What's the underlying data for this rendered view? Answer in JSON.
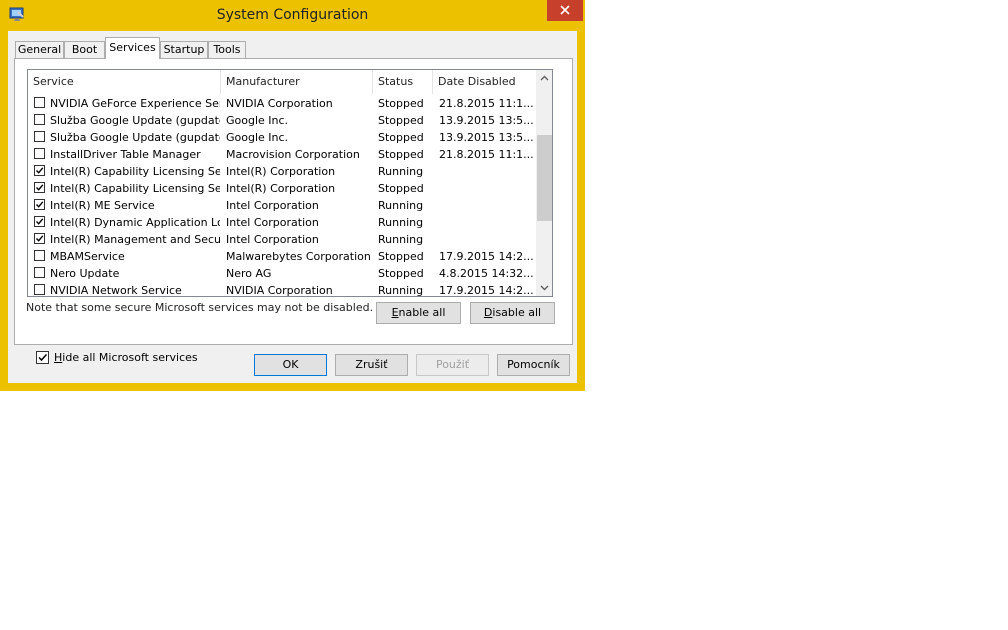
{
  "window": {
    "title": "System Configuration",
    "accent": "#ecc200",
    "close_color": "#c7402b"
  },
  "tabs": [
    {
      "label": "General",
      "active": false
    },
    {
      "label": "Boot",
      "active": false
    },
    {
      "label": "Services",
      "active": true
    },
    {
      "label": "Startup",
      "active": false
    },
    {
      "label": "Tools",
      "active": false
    }
  ],
  "services": {
    "columns": [
      "Service",
      "Manufacturer",
      "Status",
      "Date Disabled"
    ],
    "rows": [
      {
        "checked": false,
        "service": "NVIDIA GeForce Experience Ser...",
        "manufacturer": "NVIDIA Corporation",
        "status": "Stopped",
        "date": "21.8.2015 11:1..."
      },
      {
        "checked": false,
        "service": "Služba Google Update (gupdate)",
        "manufacturer": "Google Inc.",
        "status": "Stopped",
        "date": "13.9.2015 13:5..."
      },
      {
        "checked": false,
        "service": "Služba Google Update (gupdatem)",
        "manufacturer": "Google Inc.",
        "status": "Stopped",
        "date": "13.9.2015 13:5..."
      },
      {
        "checked": false,
        "service": "InstallDriver Table Manager",
        "manufacturer": "Macrovision Corporation",
        "status": "Stopped",
        "date": "21.8.2015 11:1..."
      },
      {
        "checked": true,
        "service": "Intel(R) Capability Licensing Ser...",
        "manufacturer": "Intel(R) Corporation",
        "status": "Running",
        "date": ""
      },
      {
        "checked": true,
        "service": "Intel(R) Capability Licensing Ser...",
        "manufacturer": "Intel(R) Corporation",
        "status": "Stopped",
        "date": ""
      },
      {
        "checked": true,
        "service": "Intel(R) ME Service",
        "manufacturer": "Intel Corporation",
        "status": "Running",
        "date": ""
      },
      {
        "checked": true,
        "service": "Intel(R) Dynamic Application Loa...",
        "manufacturer": "Intel Corporation",
        "status": "Running",
        "date": ""
      },
      {
        "checked": true,
        "service": "Intel(R) Management and Securi...",
        "manufacturer": "Intel Corporation",
        "status": "Running",
        "date": ""
      },
      {
        "checked": false,
        "service": "MBAMService",
        "manufacturer": "Malwarebytes Corporation",
        "status": "Stopped",
        "date": "17.9.2015 14:2..."
      },
      {
        "checked": false,
        "service": "Nero Update",
        "manufacturer": "Nero AG",
        "status": "Stopped",
        "date": "4.8.2015 14:32..."
      },
      {
        "checked": false,
        "service": "NVIDIA Network Service",
        "manufacturer": "NVIDIA Corporation",
        "status": "Running",
        "date": "17.9.2015 14:2..."
      }
    ]
  },
  "note": "Note that some secure Microsoft services may not be disabled.",
  "buttons": {
    "enable_all": {
      "accel": "E",
      "rest": "nable all"
    },
    "disable_all": {
      "accel": "D",
      "rest": "isable all"
    },
    "ok": "OK",
    "cancel": "Zrušiť",
    "apply": "Použiť",
    "help": "Pomocník"
  },
  "hide_ms": {
    "checked": true,
    "accel": "H",
    "rest": "ide all Microsoft services"
  }
}
